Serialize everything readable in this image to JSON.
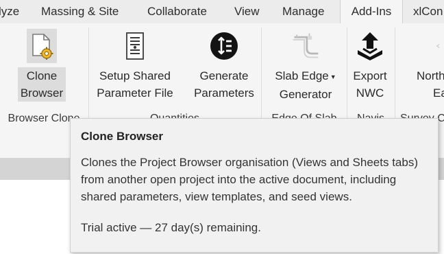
{
  "tabs": [
    {
      "label": "lyze"
    },
    {
      "label": "Massing & Site"
    },
    {
      "label": "Collaborate"
    },
    {
      "label": "View"
    },
    {
      "label": "Manage"
    },
    {
      "label": "Add-Ins"
    },
    {
      "label": "xlCon"
    }
  ],
  "active_tab": "Add-Ins",
  "ribbon": {
    "buttons": {
      "clone_browser": {
        "line1": "Clone",
        "line2": "Browser"
      },
      "setup_shared": {
        "line1": "Setup Shared",
        "line2": "Parameter File"
      },
      "generate_params": {
        "line1": "Generate",
        "line2": "Parameters"
      },
      "slab_edge": {
        "line1": "Slab Edge",
        "line2": "Generator"
      },
      "export_nwc": {
        "line1": "Export",
        "line2": "NWC"
      },
      "north": {
        "line1": "North",
        "line2": "Ea"
      }
    },
    "panels": {
      "browser_clone": "Browser Clone",
      "quantities": "Quantities",
      "edge_of_slab": "Edge Of Slab",
      "navis": "Navis",
      "survey": "Survey C"
    }
  },
  "tooltip": {
    "title": "Clone Browser",
    "description": "Clones the Project Browser organisation (Views and Sheets tabs) from another open project into the active document, including shared parameters, view templates, and seed views.",
    "status": "Trial active — 27 day(s) remaining."
  },
  "icons": {
    "clone_browser": "document-gear-icon",
    "setup_shared": "document-list-icon",
    "generate_params": "sort-circle-icon",
    "slab_edge": "slab-edge-icon",
    "export_nwc": "export-upload-icon"
  },
  "colors": {
    "tab_bar": "#ececec",
    "ribbon": "#f5f5f5",
    "tooltip_bg": "#f1f1f1"
  }
}
